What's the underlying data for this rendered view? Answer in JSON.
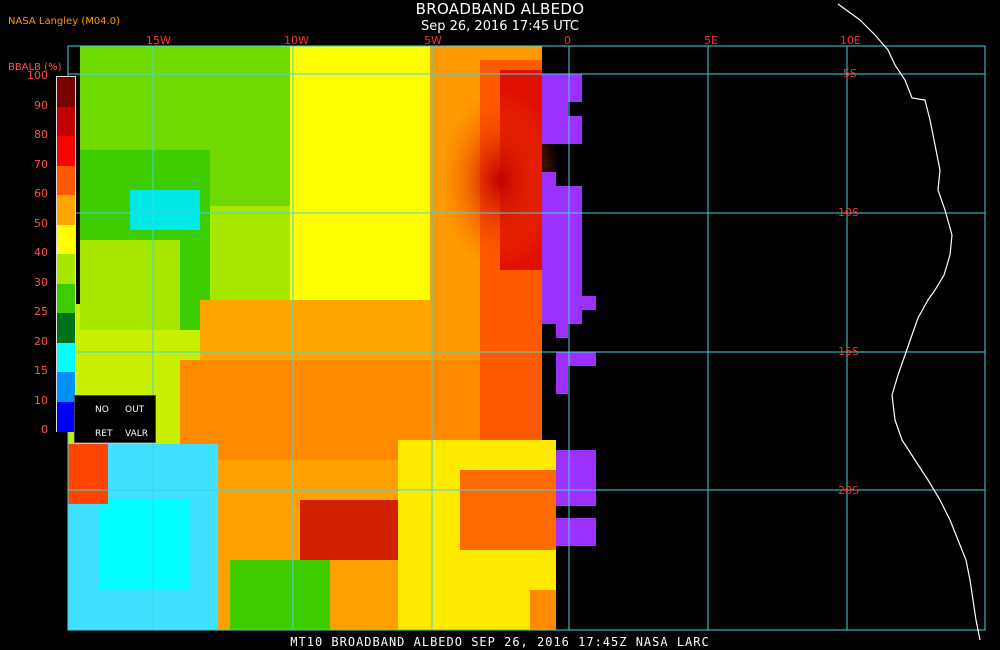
{
  "header": {
    "title": "BROADBAND ALBEDO",
    "time": "Sep 26, 2016 17:45 UTC",
    "producer": "NASA Langley (M04.0)"
  },
  "legend": {
    "title": "BBALB (%)",
    "ticks": [
      "100",
      "90",
      "80",
      "70",
      "60",
      "50",
      "40",
      "30",
      "25",
      "20",
      "15",
      "10",
      "0"
    ],
    "colors": [
      "#7a0000",
      "#c00000",
      "#ff0000",
      "#ff5a00",
      "#ffa500",
      "#ffff00",
      "#a8e800",
      "#3ccc00",
      "#00701a",
      "#00ffff",
      "#0090ff",
      "#0000ff",
      "#8a2be2"
    ],
    "no_retrieval": {
      "line1_left": "NO",
      "line1_right": "OUT",
      "line2_left": "RET",
      "line2_right": "VALR"
    }
  },
  "grid": {
    "lon_labels": [
      "15W",
      "10W",
      "5W",
      "0",
      "5E",
      "10E"
    ],
    "lat_labels": [
      "5S",
      "10S",
      "15S",
      "20S"
    ],
    "grid_color": "#3fd6e0"
  },
  "footer": "MT10  BROADBAND ALBEDO  SEP 26, 2016 17:45Z  NASA LARC"
}
